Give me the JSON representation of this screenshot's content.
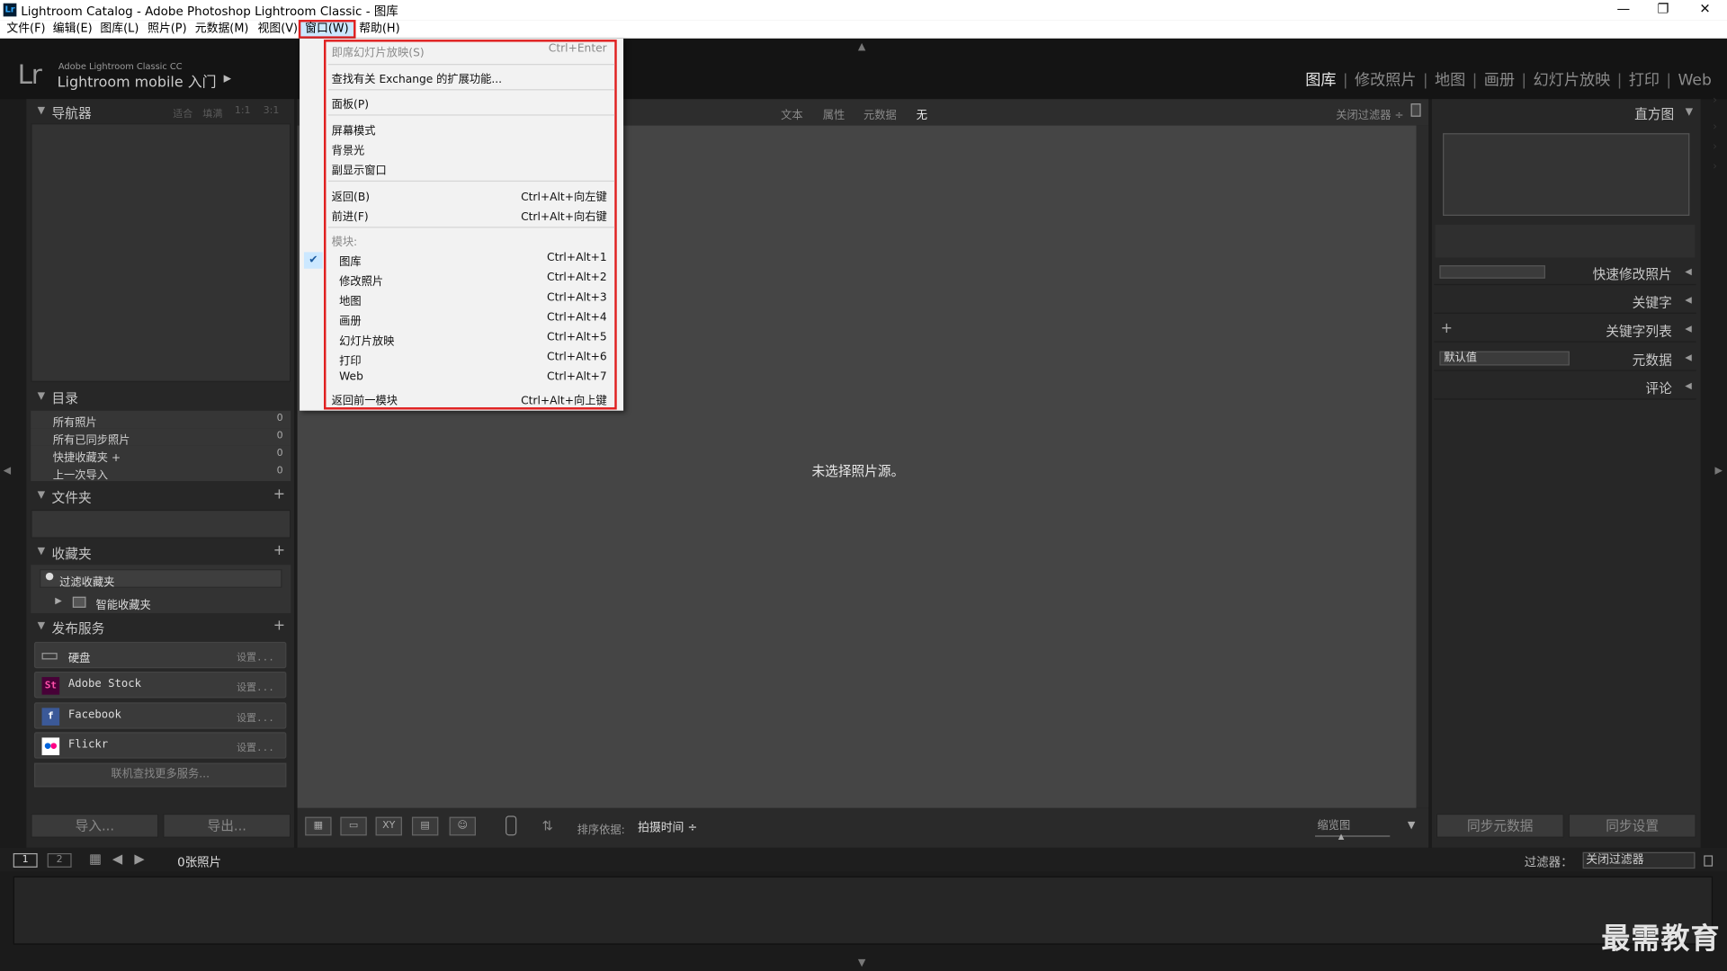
{
  "window": {
    "title": "Lightroom Catalog - Adobe Photoshop Lightroom Classic - 图库",
    "app_icon": "Lr"
  },
  "menubar": [
    "文件(F)",
    "编辑(E)",
    "图库(L)",
    "照片(P)",
    "元数据(M)",
    "视图(V)",
    "窗口(W)",
    "帮助(H)"
  ],
  "identity": {
    "logo": "Lr",
    "product": "Adobe Lightroom Classic CC",
    "mobile": "Lightroom mobile 入门",
    "arrow": "▶"
  },
  "modules": [
    "图库",
    "修改照片",
    "地图",
    "画册",
    "幻灯片放映",
    "打印",
    "Web"
  ],
  "left": {
    "navigator": {
      "title": "导航器",
      "options": [
        "适合",
        "填满",
        "1:1",
        "3:1"
      ]
    },
    "catalog": {
      "title": "目录",
      "rows": [
        {
          "label": "所有照片",
          "count": "0"
        },
        {
          "label": "所有已同步照片",
          "count": "0"
        },
        {
          "label": "快捷收藏夹 +",
          "count": "0"
        },
        {
          "label": "上一次导入",
          "count": "0"
        }
      ]
    },
    "folders": {
      "title": "文件夹"
    },
    "collections": {
      "title": "收藏夹",
      "filter": "过滤收藏夹",
      "smart": "智能收藏夹"
    },
    "publish": {
      "title": "发布服务",
      "services": [
        {
          "name": "硬盘",
          "settings": "设置...",
          "icon": "drive-icon"
        },
        {
          "name": "Adobe Stock",
          "settings": "设置...",
          "icon": "St"
        },
        {
          "name": "Facebook",
          "settings": "设置...",
          "icon": "f"
        },
        {
          "name": "Flickr",
          "settings": "设置...",
          "icon": "flickr-icon"
        }
      ],
      "more": "联机查找更多服务..."
    },
    "import_label": "导入...",
    "export_label": "导出..."
  },
  "filterbar": {
    "options": [
      "文本",
      "属性",
      "元数据",
      "无"
    ],
    "close": "关闭过滤器 ÷"
  },
  "center": {
    "message": "未选择照片源。"
  },
  "toolbar": {
    "sort_label": "排序依据:",
    "sort_value": "拍摄时间 ÷",
    "zoom_label": "缩览图"
  },
  "right": {
    "histogram": "直方图",
    "quick_develop": "快速修改照片",
    "keywording": "关键字",
    "keyword_list": "关键字列表",
    "metadata": "元数据",
    "metadata_preset": "默认值",
    "comments": "评论",
    "sync_metadata": "同步元数据",
    "sync_settings": "同步设置"
  },
  "filmstrip": {
    "count": "0张照片",
    "filter_label": "过滤器：",
    "filter_value": "关闭过滤器",
    "page1": "1",
    "page2": "2"
  },
  "watermark": "最需教育",
  "dropdown": {
    "items": [
      {
        "label": "即席幻灯片放映(S)",
        "shortcut": "Ctrl+Enter",
        "disabled": true
      },
      {
        "label": "查找有关 Exchange 的扩展功能...",
        "shortcut": ""
      },
      {
        "label": "面板(P)",
        "shortcut": ""
      },
      {
        "label": "屏幕模式",
        "shortcut": ""
      },
      {
        "label": "背景光",
        "shortcut": ""
      },
      {
        "label": "副显示窗口",
        "shortcut": ""
      },
      {
        "label": "返回(B)",
        "shortcut": "Ctrl+Alt+向左键"
      },
      {
        "label": "前进(F)",
        "shortcut": "Ctrl+Alt+向右键"
      },
      {
        "label": "模块:",
        "shortcut": "",
        "disabled": true
      },
      {
        "label": "图库",
        "shortcut": "Ctrl+Alt+1",
        "checked": true
      },
      {
        "label": "修改照片",
        "shortcut": "Ctrl+Alt+2"
      },
      {
        "label": "地图",
        "shortcut": "Ctrl+Alt+3"
      },
      {
        "label": "画册",
        "shortcut": "Ctrl+Alt+4"
      },
      {
        "label": "幻灯片放映",
        "shortcut": "Ctrl+Alt+5"
      },
      {
        "label": "打印",
        "shortcut": "Ctrl+Alt+6"
      },
      {
        "label": "Web",
        "shortcut": "Ctrl+Alt+7"
      },
      {
        "label": "返回前一模块",
        "shortcut": "Ctrl+Alt+向上键"
      }
    ]
  },
  "colors": {
    "highlight_border": "#e02020",
    "menu_hover": "#cce8ff",
    "panel": "#2b2b2b",
    "grid": "#454545"
  }
}
